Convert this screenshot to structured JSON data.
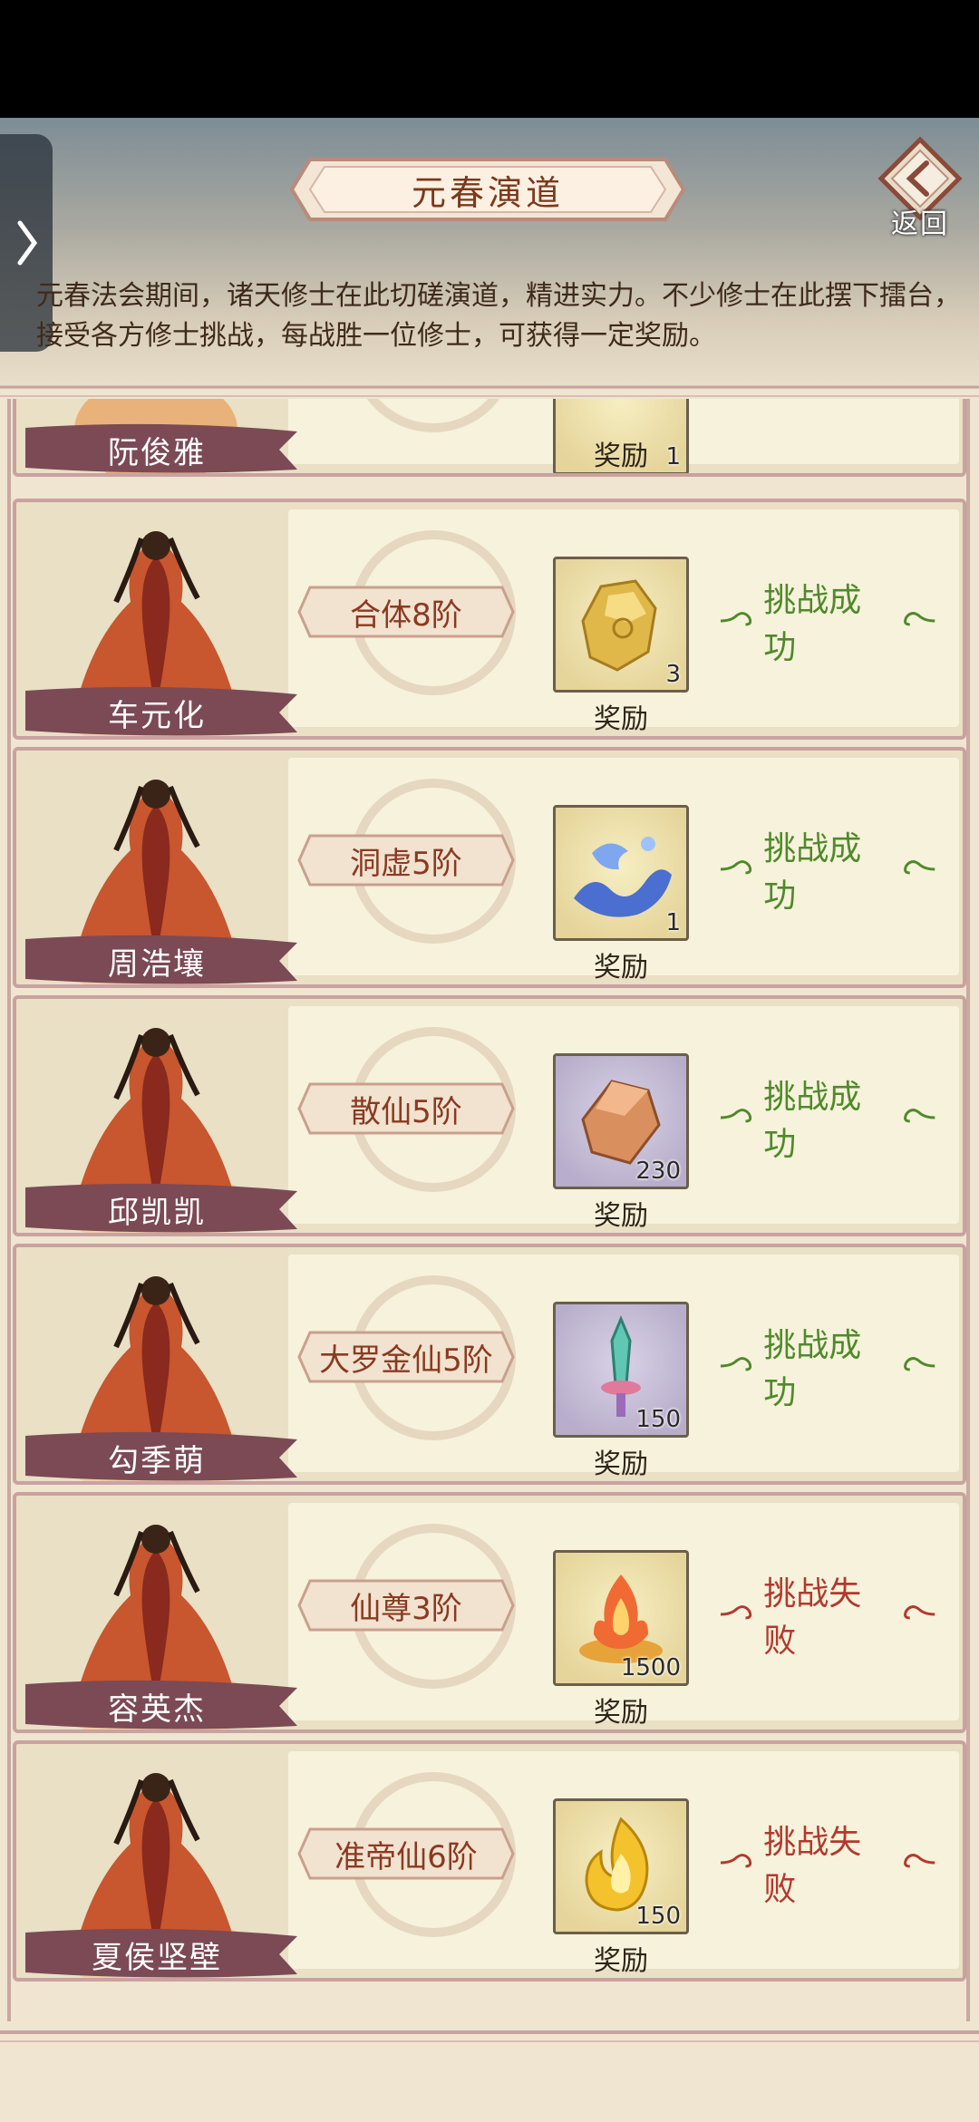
{
  "header": {
    "title": "元春演道",
    "back_label": "返回",
    "description": "元春法会期间，诸天修士在此切磋演道，精进实力。不少修士在此摆下擂台，接受各方修士挑战，每战胜一位修士，可获得一定奖励。"
  },
  "reward_label": "奖励",
  "partial_card": {
    "name": "阮俊雅",
    "reward_count": "1",
    "reward_label": "奖励"
  },
  "challengers": [
    {
      "name": "车元化",
      "rank": "合体8阶",
      "reward_icon": "gold-ore-icon",
      "reward_count": "3",
      "status": "挑战成功",
      "status_type": "success"
    },
    {
      "name": "周浩壤",
      "rank": "洞虚5阶",
      "reward_icon": "blue-water-spirit-icon",
      "reward_count": "1",
      "status": "挑战成功",
      "status_type": "success"
    },
    {
      "name": "邱凯凯",
      "rank": "散仙5阶",
      "reward_icon": "copper-crystal-icon",
      "reward_count": "230",
      "status": "挑战成功",
      "status_type": "success"
    },
    {
      "name": "勾季萌",
      "rank": "大罗金仙5阶",
      "reward_icon": "jade-sword-icon",
      "reward_count": "150",
      "status": "挑战成功",
      "status_type": "success"
    },
    {
      "name": "容英杰",
      "rank": "仙尊3阶",
      "reward_icon": "flame-altar-icon",
      "reward_count": "1500",
      "status": "挑战失败",
      "status_type": "fail"
    },
    {
      "name": "夏侯坚壁",
      "rank": "准帝仙6阶",
      "reward_icon": "golden-flame-icon",
      "reward_count": "150",
      "status": "挑战失败",
      "status_type": "fail"
    }
  ],
  "colors": {
    "success": "#4f8a2a",
    "fail": "#b03a2e",
    "card_border": "#c9a2a0",
    "banner": "#7b4a55"
  }
}
